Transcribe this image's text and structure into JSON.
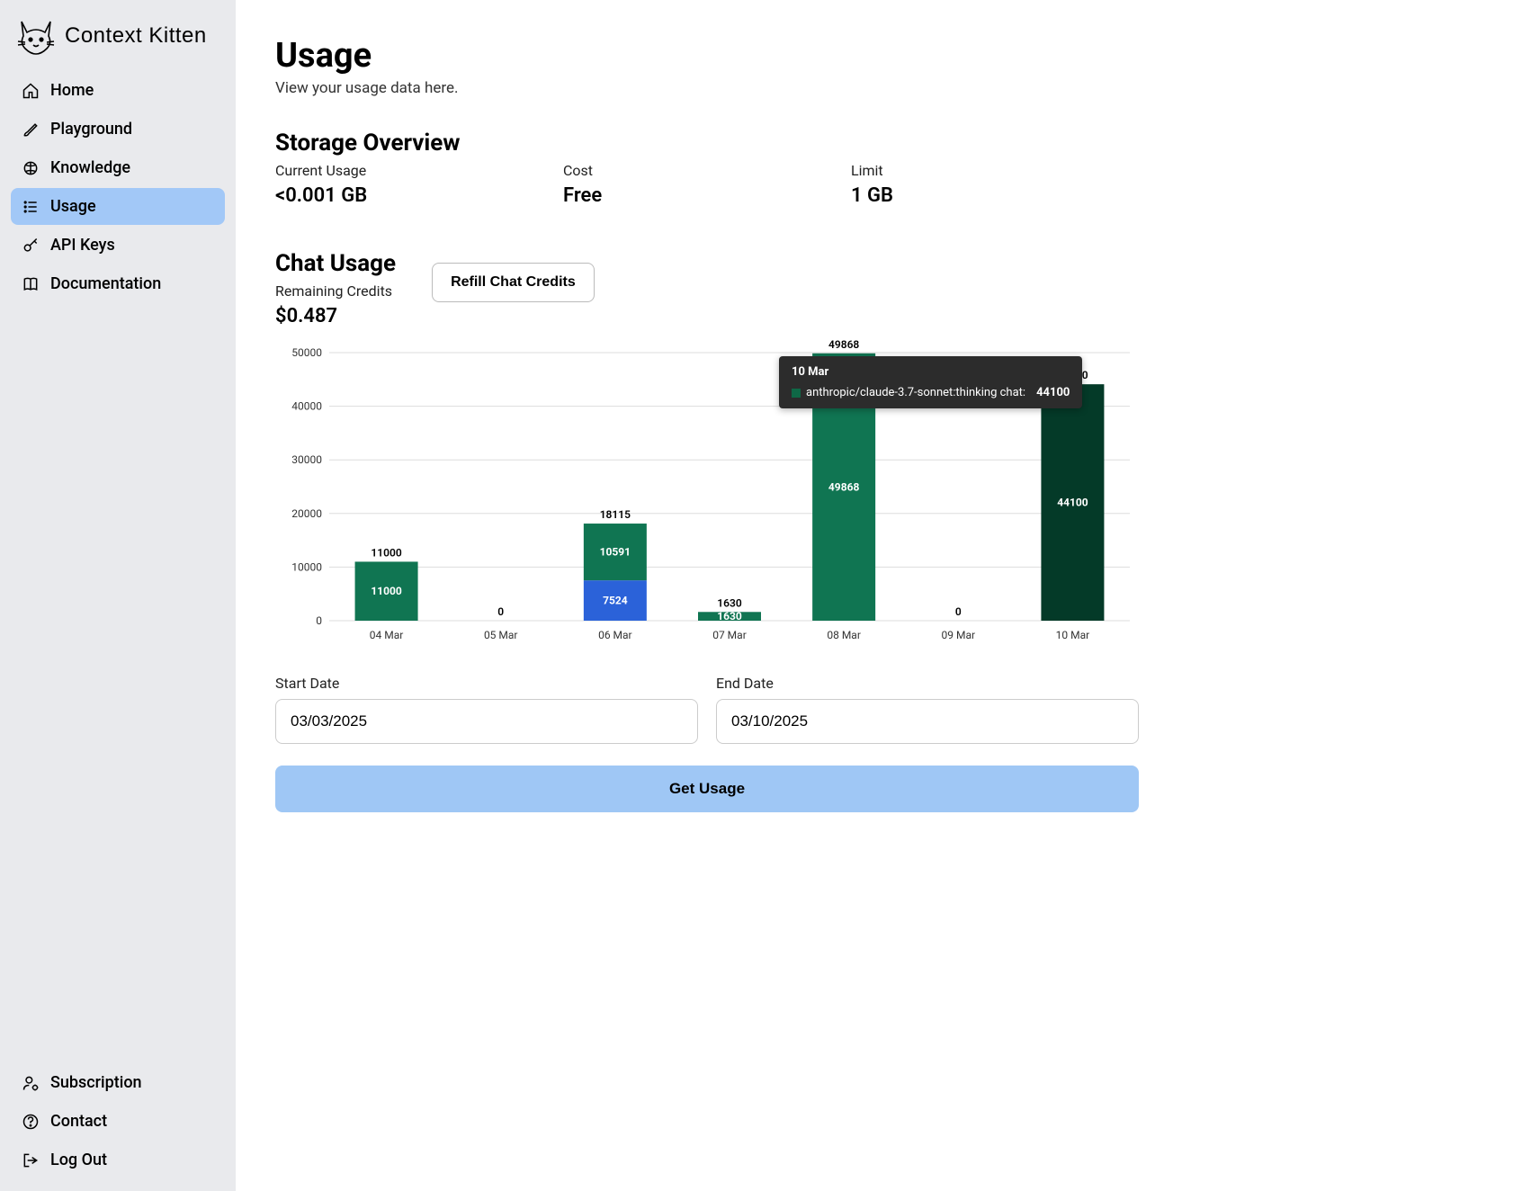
{
  "brand": "Context Kitten",
  "nav": {
    "items": [
      {
        "key": "home",
        "label": "Home"
      },
      {
        "key": "playground",
        "label": "Playground"
      },
      {
        "key": "knowledge",
        "label": "Knowledge"
      },
      {
        "key": "usage",
        "label": "Usage"
      },
      {
        "key": "api-keys",
        "label": "API Keys"
      },
      {
        "key": "documentation",
        "label": "Documentation"
      }
    ],
    "bottom": [
      {
        "key": "subscription",
        "label": "Subscription"
      },
      {
        "key": "contact",
        "label": "Contact"
      },
      {
        "key": "logout",
        "label": "Log Out"
      }
    ],
    "active": "usage"
  },
  "page": {
    "title": "Usage",
    "subtitle": "View your usage data here."
  },
  "storage": {
    "heading": "Storage Overview",
    "current_label": "Current Usage",
    "current_value": "<0.001 GB",
    "cost_label": "Cost",
    "cost_value": "Free",
    "limit_label": "Limit",
    "limit_value": "1 GB"
  },
  "chat": {
    "heading": "Chat Usage",
    "remaining_label": "Remaining Credits",
    "remaining_value": "$0.487",
    "refill_label": "Refill Chat Credits"
  },
  "tooltip": {
    "date": "10 Mar",
    "series_label": "anthropic/claude-3.7-sonnet:thinking chat:",
    "value": "44100"
  },
  "dates": {
    "start_label": "Start Date",
    "start_value": "03/03/2025",
    "end_label": "End Date",
    "end_value": "03/10/2025",
    "get_usage_label": "Get Usage"
  },
  "chart_data": {
    "type": "bar",
    "stacked": true,
    "categories": [
      "04 Mar",
      "05 Mar",
      "06 Mar",
      "07 Mar",
      "08 Mar",
      "09 Mar",
      "10 Mar"
    ],
    "series": [
      {
        "name": "anthropic/claude-3.7-sonnet:thinking chat",
        "color": "#107552",
        "values": [
          11000,
          0,
          10591,
          1630,
          49868,
          0,
          44100
        ]
      },
      {
        "name": "series_b",
        "color": "#2b62d9",
        "values": [
          0,
          0,
          7524,
          0,
          0,
          0,
          0
        ]
      }
    ],
    "totals": [
      11000,
      0,
      18115,
      1630,
      49868,
      0,
      44100
    ],
    "ylim": [
      0,
      50000
    ],
    "yticks": [
      0,
      10000,
      20000,
      30000,
      40000,
      50000
    ],
    "highlighted_index": 6,
    "highlight_color": "#043a28"
  }
}
